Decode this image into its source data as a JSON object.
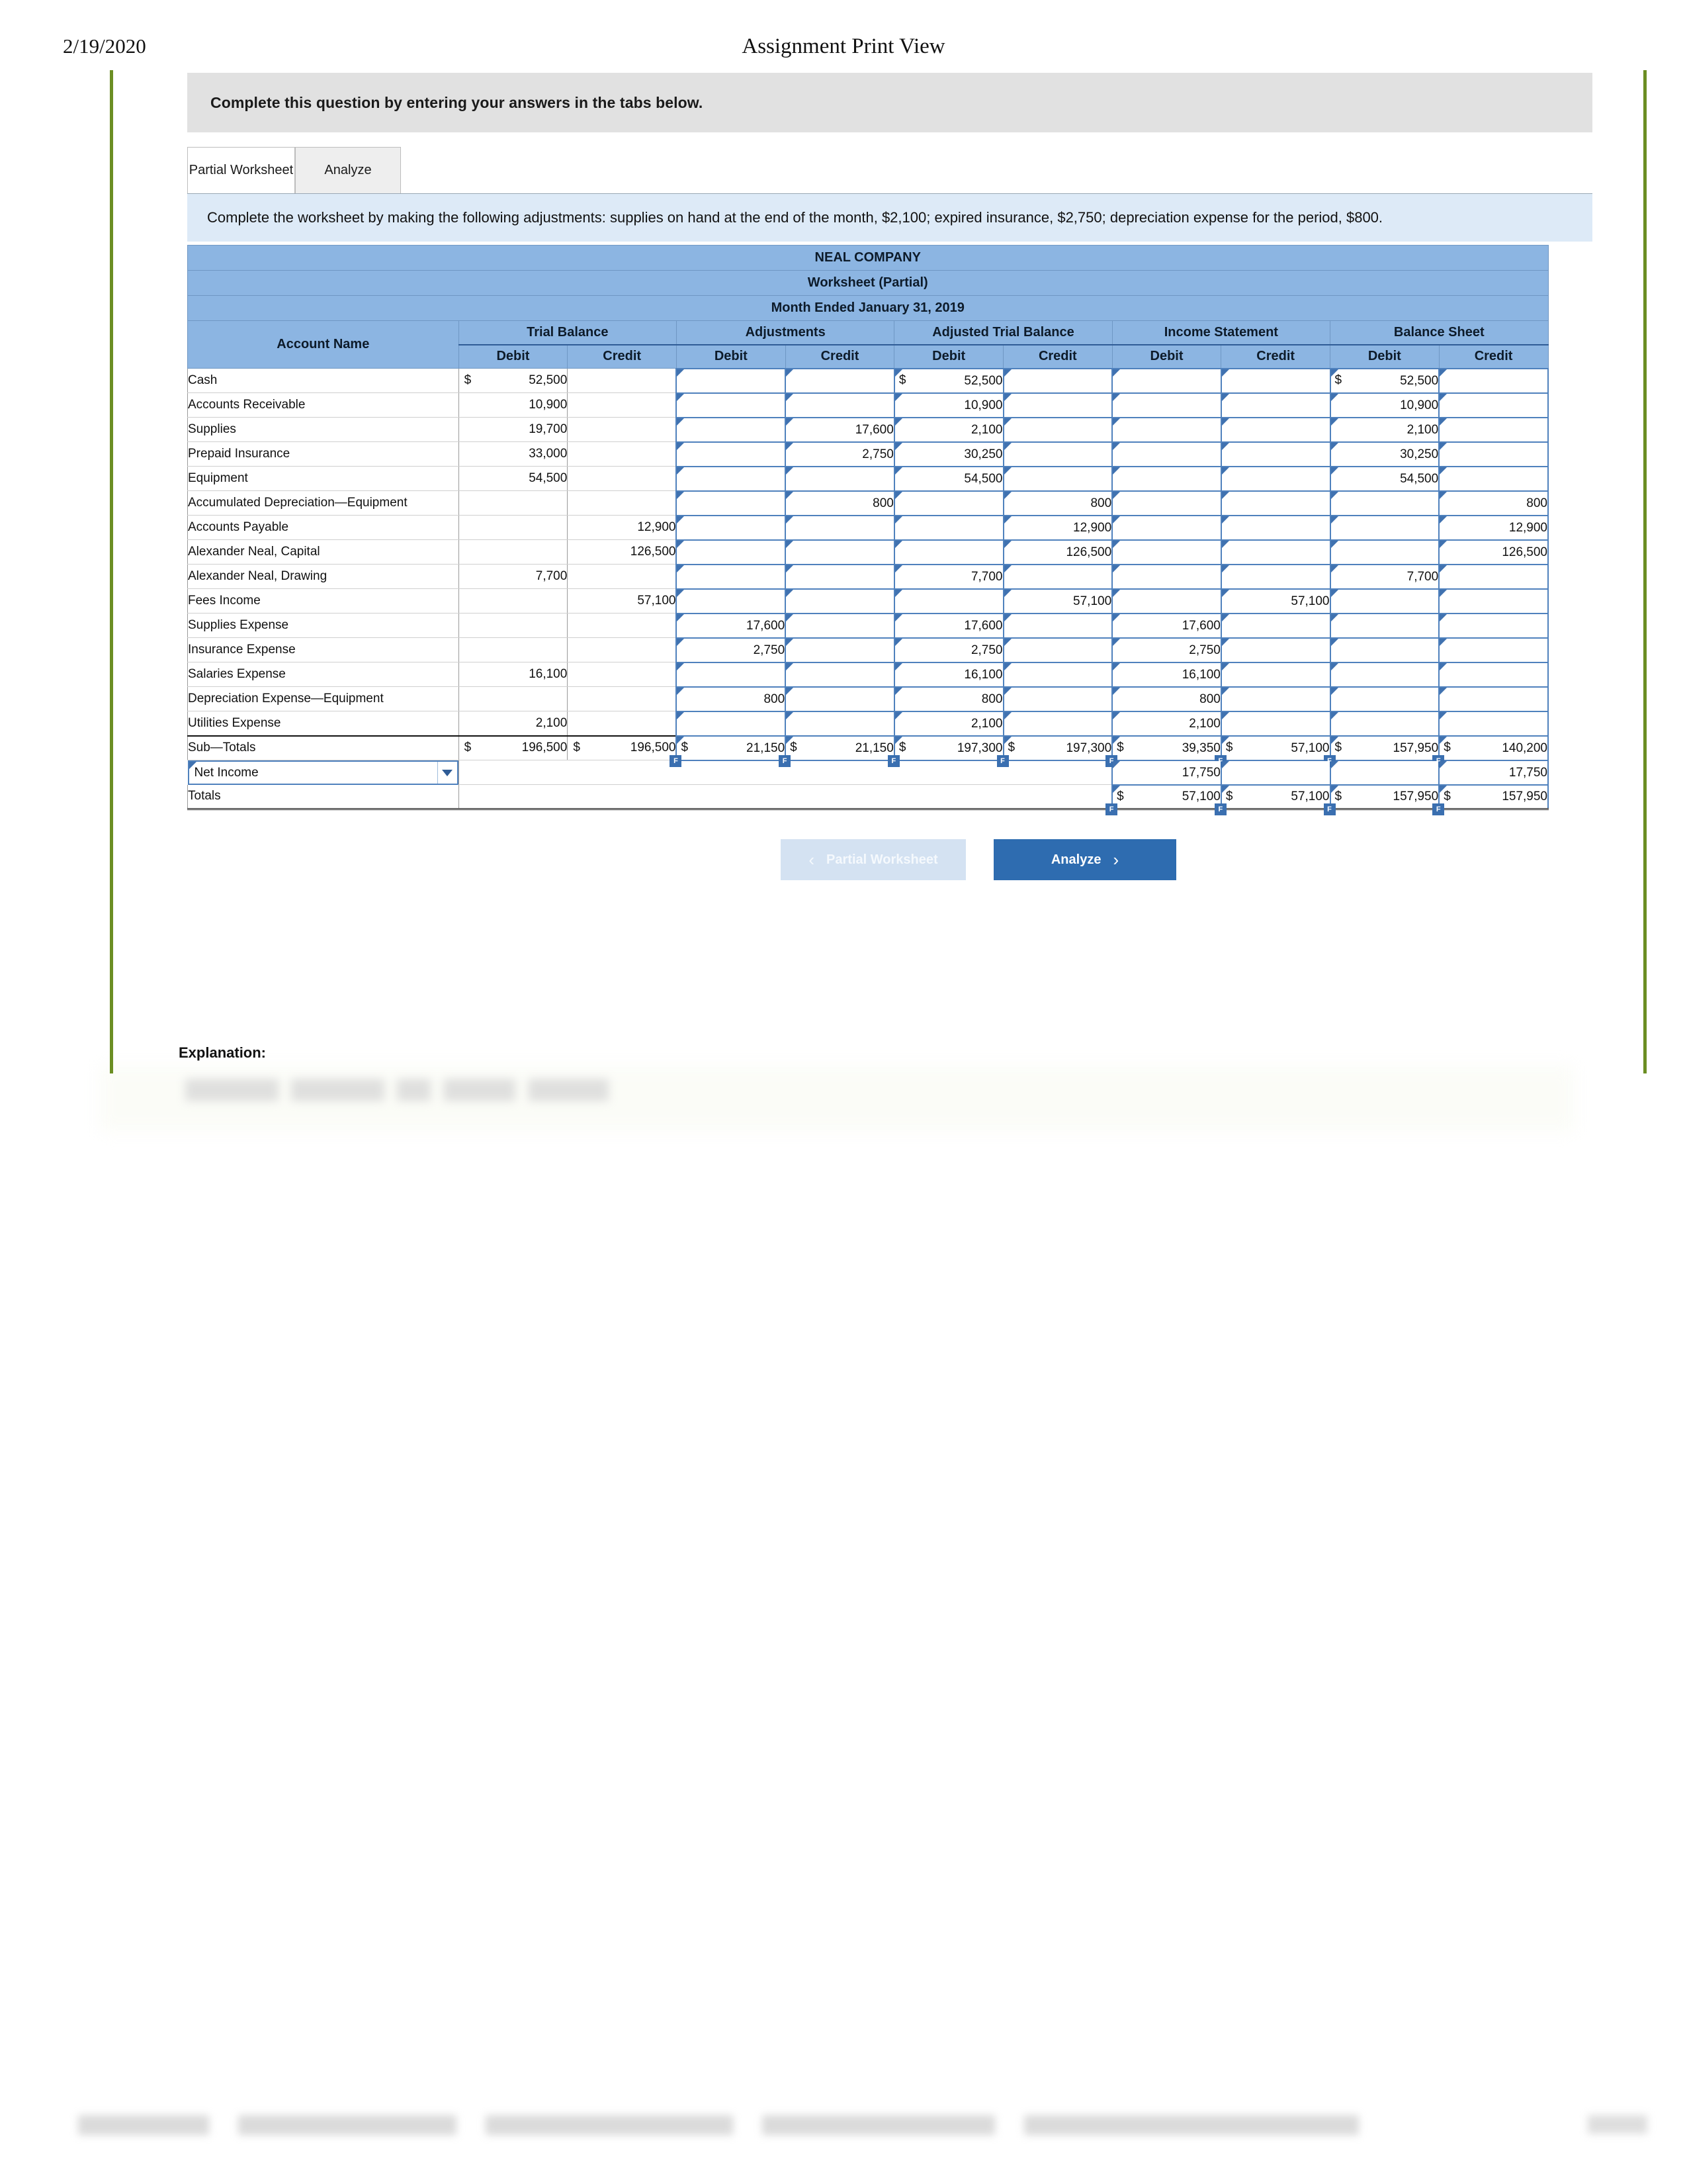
{
  "print_header": {
    "date": "2/19/2020",
    "title": "Assignment Print View"
  },
  "banner": {
    "text": "Complete this question by entering your answers in the tabs below."
  },
  "tabs": [
    {
      "label": "Partial Worksheet",
      "active": true
    },
    {
      "label": "Analyze",
      "active": false
    }
  ],
  "instruction": {
    "text": "Complete the worksheet by making the following adjustments: supplies on hand at the end of the month, $2,100; expired insurance, $2,750; depreciation expense for the period, $800."
  },
  "worksheet": {
    "title_lines": [
      "NEAL COMPANY",
      "Worksheet (Partial)",
      "Month Ended January 31, 2019"
    ],
    "account_header": "Account Name",
    "column_groups": [
      "Trial Balance",
      "Adjustments",
      "Adjusted Trial Balance",
      "Income Statement",
      "Balance Sheet"
    ],
    "debit_label": "Debit",
    "credit_label": "Credit",
    "dollar": "$",
    "rows": [
      {
        "name": "Cash",
        "tb_debit": "52,500",
        "tb_debit_dollar": "$",
        "tb_credit": "",
        "adj_debit": "",
        "adj_credit": "",
        "atb_debit": "52,500",
        "atb_debit_dollar": "$",
        "atb_credit": "",
        "is_debit": "",
        "is_credit": "",
        "bs_debit": "52,500",
        "bs_debit_dollar": "$",
        "bs_credit": ""
      },
      {
        "name": "Accounts Receivable",
        "tb_debit": "10,900",
        "tb_credit": "",
        "adj_debit": "",
        "adj_credit": "",
        "atb_debit": "10,900",
        "atb_credit": "",
        "is_debit": "",
        "is_credit": "",
        "bs_debit": "10,900",
        "bs_credit": ""
      },
      {
        "name": "Supplies",
        "tb_debit": "19,700",
        "tb_credit": "",
        "adj_debit": "",
        "adj_credit": "17,600",
        "atb_debit": "2,100",
        "atb_credit": "",
        "is_debit": "",
        "is_credit": "",
        "bs_debit": "2,100",
        "bs_credit": ""
      },
      {
        "name": "Prepaid Insurance",
        "tb_debit": "33,000",
        "tb_credit": "",
        "adj_debit": "",
        "adj_credit": "2,750",
        "atb_debit": "30,250",
        "atb_credit": "",
        "is_debit": "",
        "is_credit": "",
        "bs_debit": "30,250",
        "bs_credit": ""
      },
      {
        "name": "Equipment",
        "tb_debit": "54,500",
        "tb_credit": "",
        "adj_debit": "",
        "adj_credit": "",
        "atb_debit": "54,500",
        "atb_credit": "",
        "is_debit": "",
        "is_credit": "",
        "bs_debit": "54,500",
        "bs_credit": ""
      },
      {
        "name": "Accumulated Depreciation—Equipment",
        "tb_debit": "",
        "tb_credit": "",
        "adj_debit": "",
        "adj_credit": "800",
        "atb_debit": "",
        "atb_credit": "800",
        "is_debit": "",
        "is_credit": "",
        "bs_debit": "",
        "bs_credit": "800"
      },
      {
        "name": "Accounts Payable",
        "tb_debit": "",
        "tb_credit": "12,900",
        "adj_debit": "",
        "adj_credit": "",
        "atb_debit": "",
        "atb_credit": "12,900",
        "is_debit": "",
        "is_credit": "",
        "bs_debit": "",
        "bs_credit": "12,900"
      },
      {
        "name": "Alexander Neal, Capital",
        "tb_debit": "",
        "tb_credit": "126,500",
        "adj_debit": "",
        "adj_credit": "",
        "atb_debit": "",
        "atb_credit": "126,500",
        "is_debit": "",
        "is_credit": "",
        "bs_debit": "",
        "bs_credit": "126,500"
      },
      {
        "name": "Alexander Neal, Drawing",
        "tb_debit": "7,700",
        "tb_credit": "",
        "adj_debit": "",
        "adj_credit": "",
        "atb_debit": "7,700",
        "atb_credit": "",
        "is_debit": "",
        "is_credit": "",
        "bs_debit": "7,700",
        "bs_credit": ""
      },
      {
        "name": "Fees Income",
        "tb_debit": "",
        "tb_credit": "57,100",
        "adj_debit": "",
        "adj_credit": "",
        "atb_debit": "",
        "atb_credit": "57,100",
        "is_debit": "",
        "is_credit": "57,100",
        "bs_debit": "",
        "bs_credit": ""
      },
      {
        "name": "Supplies Expense",
        "tb_debit": "",
        "tb_credit": "",
        "adj_debit": "17,600",
        "adj_credit": "",
        "atb_debit": "17,600",
        "atb_credit": "",
        "is_debit": "17,600",
        "is_credit": "",
        "bs_debit": "",
        "bs_credit": ""
      },
      {
        "name": "Insurance Expense",
        "tb_debit": "",
        "tb_credit": "",
        "adj_debit": "2,750",
        "adj_credit": "",
        "atb_debit": "2,750",
        "atb_credit": "",
        "is_debit": "2,750",
        "is_credit": "",
        "bs_debit": "",
        "bs_credit": ""
      },
      {
        "name": "Salaries Expense",
        "tb_debit": "16,100",
        "tb_credit": "",
        "adj_debit": "",
        "adj_credit": "",
        "atb_debit": "16,100",
        "atb_credit": "",
        "is_debit": "16,100",
        "is_credit": "",
        "bs_debit": "",
        "bs_credit": ""
      },
      {
        "name": "Depreciation Expense—Equipment",
        "tb_debit": "",
        "tb_credit": "",
        "adj_debit": "800",
        "adj_credit": "",
        "atb_debit": "800",
        "atb_credit": "",
        "is_debit": "800",
        "is_credit": "",
        "bs_debit": "",
        "bs_credit": ""
      },
      {
        "name": "Utilities Expense",
        "tb_debit": "2,100",
        "tb_credit": "",
        "adj_debit": "",
        "adj_credit": "",
        "atb_debit": "2,100",
        "atb_credit": "",
        "is_debit": "2,100",
        "is_credit": "",
        "bs_debit": "",
        "bs_credit": ""
      }
    ],
    "subtotals": {
      "name": "Sub—Totals",
      "tb_debit": "196,500",
      "tb_credit": "196,500",
      "adj_debit": "21,150",
      "adj_credit": "21,150",
      "atb_debit": "197,300",
      "atb_credit": "197,300",
      "is_debit": "39,350",
      "is_credit": "57,100",
      "bs_debit": "157,950",
      "bs_credit": "140,200"
    },
    "net_income": {
      "name": "Net Income",
      "is_debit": "17,750",
      "is_credit": "",
      "bs_debit": "",
      "bs_credit": "17,750"
    },
    "totals": {
      "name": "Totals",
      "is_debit": "57,100",
      "is_credit": "57,100",
      "bs_debit": "157,950",
      "bs_credit": "157,950"
    }
  },
  "nav": {
    "prev_label": "Partial Worksheet",
    "prev_icon": "chevron-left",
    "next_label": "Analyze",
    "next_icon": "chevron-right"
  },
  "explanation": {
    "label": "Explanation:"
  },
  "colors": {
    "header_blue": "#8cb5e2",
    "instruction_blue": "#ddeaf7",
    "banner_grey": "#e1e1e1",
    "input_border": "#4f81bd",
    "primary_button": "#2e6cb0",
    "disabled_button": "#d4e2f2",
    "page_rule": "#6b8e23"
  }
}
